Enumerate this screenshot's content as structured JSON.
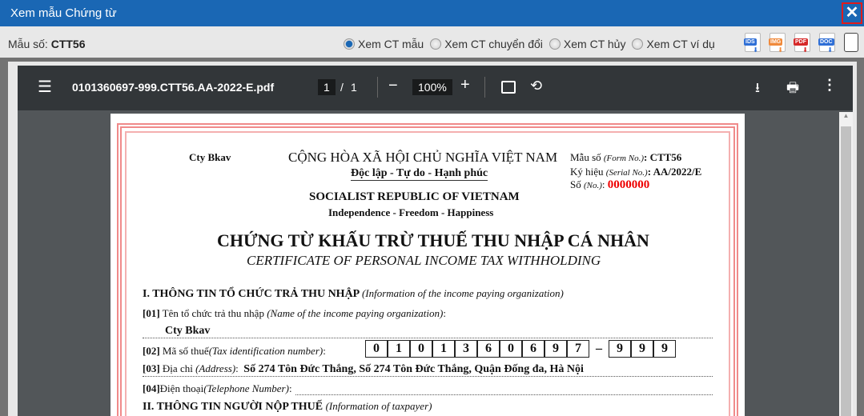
{
  "window": {
    "title": "Xem mẫu Chứng từ",
    "close": "✕"
  },
  "toolbar": {
    "mau_label": "Mẫu số: ",
    "mau_value": "CTT56",
    "radios": [
      {
        "label": "Xem CT mẫu",
        "checked": true
      },
      {
        "label": "Xem CT chuyển đổi"
      },
      {
        "label": "Xem CT hủy"
      },
      {
        "label": "Xem CT ví dụ"
      }
    ],
    "files": [
      {
        "label": "IDS",
        "color": "#2f6fd6"
      },
      {
        "label": "IMG",
        "color": "#f08a3c"
      },
      {
        "label": "PDF",
        "color": "#d62828"
      },
      {
        "label": "DOC",
        "color": "#2f6fd6"
      }
    ]
  },
  "pdf": {
    "filename": "0101360697-999.CTT56.AA-2022-E.pdf",
    "page": "1",
    "sep": "/",
    "total": "1",
    "zoom": "100%"
  },
  "doc": {
    "company": "Cty Bkav",
    "nation_vi": "CỘNG HÒA XÃ HỘI CHỦ NGHĨA VIỆT NAM",
    "motto_vi": "Độc lập - Tự do - Hạnh phúc",
    "nation_en": "SOCIALIST REPUBLIC OF VIETNAM",
    "motto_en": "Independence - Freedom - Happiness",
    "form_label": "Mẫu số ",
    "form_label_en": "(Form No.)",
    "form_value": ": CTT56",
    "serial_label": "Ký hiệu ",
    "serial_label_en": "(Serial No.)",
    "serial_value": ": AA/2022/E",
    "no_label": "Số ",
    "no_label_en": "(No.)",
    "no_colon": ": ",
    "no_value": "0000000",
    "title_vi": "CHỨNG TỪ KHẤU TRỪ THUẾ THU NHẬP CÁ NHÂN",
    "title_en": "CERTIFICATE OF PERSONAL INCOME TAX WITHHOLDING",
    "s1": "I. THÔNG TIN TỔ CHỨC TRẢ THU NHẬP ",
    "s1_en": "(Information of the income paying organization)",
    "f01": "[01]",
    "f01_label": " Tên tổ chức trả thu nhập ",
    "f01_en": "(Name of the income paying organization)",
    "colon": ":",
    "f01_value": "Cty Bkav",
    "f02": "[02]",
    "f02_label": " Mã số thuế",
    "f02_en": "(Tax identification number)",
    "tax_digits": [
      "0",
      "1",
      "0",
      "1",
      "3",
      "6",
      "0",
      "6",
      "9",
      "7"
    ],
    "tax_dash": "–",
    "tax_suffix": [
      "9",
      "9",
      "9"
    ],
    "f03": "[03]",
    "f03_label": " Địa chỉ ",
    "f03_en": "(Address)",
    "f03_value": "Số 274 Tôn Đức Thắng, Số 274 Tôn Đức Thắng, Quận Đống đa, Hà Nội",
    "f04": "[04]",
    "f04_label": " Điện thoại ",
    "f04_en": "(Telephone Number)",
    "s2": "II. THÔNG TIN NGƯỜI NỘP THUẾ ",
    "s2_en": "(Information of taxpayer)"
  }
}
